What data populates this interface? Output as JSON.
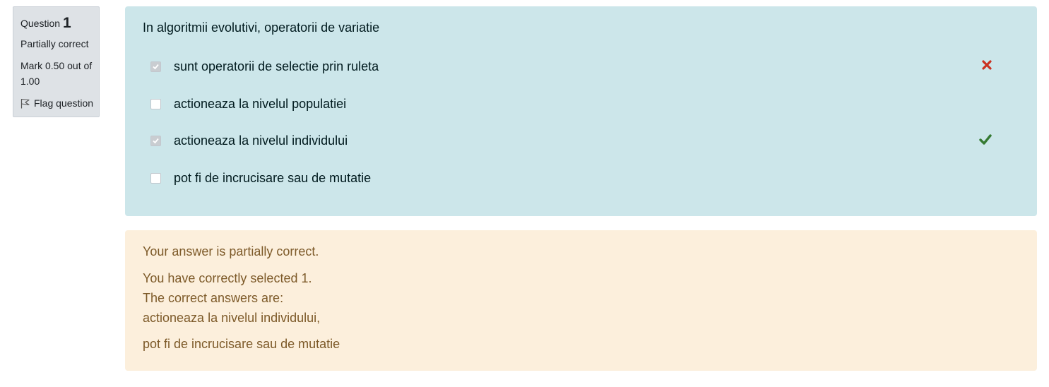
{
  "info": {
    "question_label": "Question",
    "question_number": "1",
    "state": "Partially correct",
    "mark": "Mark 0.50 out of 1.00",
    "flag_label": "Flag question"
  },
  "question": {
    "text": "In algoritmii evolutivi, operatorii de variatie",
    "options": [
      {
        "label": "sunt operatorii de selectie prin ruleta",
        "checked": true,
        "feedback_icon": "cross-icon"
      },
      {
        "label": "actioneaza la nivelul populatiei",
        "checked": false,
        "feedback_icon": null
      },
      {
        "label": "actioneaza la nivelul individului",
        "checked": true,
        "feedback_icon": "check-icon"
      },
      {
        "label": "pot fi de incrucisare sau de mutatie",
        "checked": false,
        "feedback_icon": null
      }
    ]
  },
  "feedback": {
    "general": "Your answer is partially correct.",
    "selected": "You have correctly selected 1.",
    "correct_intro": "The correct answers are:",
    "correct_1": "actioneaza la nivelul individului,",
    "correct_2": "pot fi de incrucisare sau de mutatie"
  },
  "colors": {
    "question_bg": "#cce6ea",
    "feedback_bg": "#fcefdc",
    "info_bg": "#dee2e6",
    "incorrect": "#ca3120",
    "correct": "#357a32"
  }
}
